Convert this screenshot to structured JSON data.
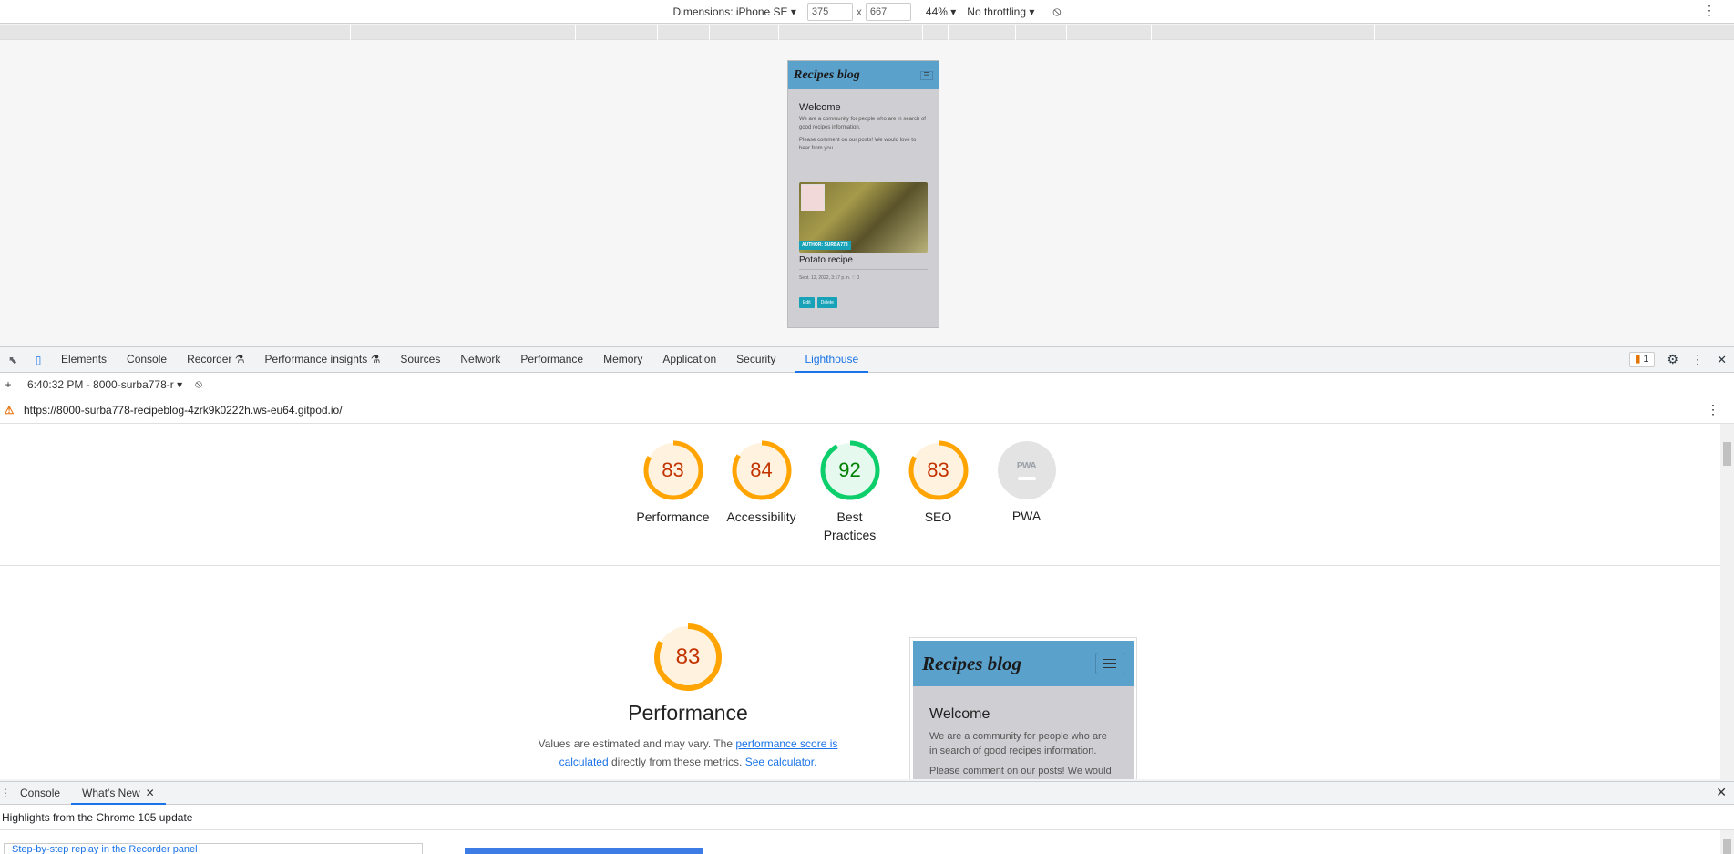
{
  "device_toolbar": {
    "dimensions_label": "Dimensions: iPhone SE ▾",
    "width": "375",
    "height": "667",
    "x_sep": "x",
    "zoom": "44% ▾",
    "throttling": "No throttling ▾",
    "rotate_icon": "⦸",
    "more_icon": "⋮"
  },
  "phone_preview": {
    "brand": "Recipes blog",
    "toggler_icon": "☰",
    "welcome": "Welcome",
    "text1": "We are a community for people who are in search of good recipes information.",
    "text2": "Please comment on our posts! We would love to hear from you.",
    "author_badge": "AUTHOR: SURBA778",
    "post_title": "Potato recipe",
    "post_meta": "Sept. 12, 2022, 3:17 p.m. ♡ 0",
    "edit_label": "Edit",
    "delete_label": "Delete"
  },
  "devtools_tabs": {
    "items": [
      {
        "label": "Elements"
      },
      {
        "label": "Console"
      },
      {
        "label": "Recorder ⚗"
      },
      {
        "label": "Performance insights ⚗"
      },
      {
        "label": "Sources"
      },
      {
        "label": "Network"
      },
      {
        "label": "Performance"
      },
      {
        "label": "Memory"
      },
      {
        "label": "Application"
      },
      {
        "label": "Security"
      },
      {
        "label": "Lighthouse"
      }
    ],
    "issues_count": "1",
    "inspect_icon": "⬉",
    "device_icon": "▯",
    "settings_icon": "⚙",
    "more_icon": "⋮",
    "close_icon": "✕"
  },
  "lighthouse_toolbar": {
    "plus_icon": "+",
    "report_label": "6:40:32 PM - 8000-surba778-r ▾",
    "clear_icon": "⦸"
  },
  "lighthouse_url": {
    "lock_icon": "⚠",
    "url": "https://8000-surba778-recipeblog-4zrk9k0222h.ws-eu64.gitpod.io/",
    "more_icon": "⋮"
  },
  "scores": {
    "items": [
      {
        "label": "Performance",
        "value": "83",
        "score": 0.83,
        "color": "#ffa400",
        "text_color": "#c33300",
        "bg": "#fff3e0"
      },
      {
        "label": "Accessibility",
        "value": "84",
        "score": 0.84,
        "color": "#ffa400",
        "text_color": "#c33300",
        "bg": "#fff3e0"
      },
      {
        "label": "Best Practices",
        "value": "92",
        "score": 0.92,
        "color": "#0cce6b",
        "text_color": "#008000",
        "bg": "#e6f9ee"
      },
      {
        "label": "SEO",
        "value": "83",
        "score": 0.83,
        "color": "#ffa400",
        "text_color": "#c33300",
        "bg": "#fff3e0"
      }
    ],
    "pwa": {
      "label": "PWA",
      "badge_text": "PWA"
    }
  },
  "performance_section": {
    "score": "83",
    "score_fraction": 0.83,
    "title": "Performance",
    "desc_pre": "Values are estimated and may vary. The ",
    "link1": "performance score is calculated",
    "desc_mid": " directly from these metrics. ",
    "link2": "See calculator."
  },
  "screenshot_preview": {
    "brand": "Recipes blog",
    "welcome": "Welcome",
    "text1": "We are a community for people who are in search of good recipes information.",
    "text2": "Please comment on our posts! We would"
  },
  "drawer": {
    "dots_icon": "⋮",
    "tabs": [
      {
        "label": "Console"
      },
      {
        "label": "What's New"
      }
    ],
    "close_tab_icon": "✕",
    "close_icon": "✕",
    "header": "Highlights from the Chrome 105 update",
    "card_text": "Step-by-step replay in the Recorder panel"
  }
}
